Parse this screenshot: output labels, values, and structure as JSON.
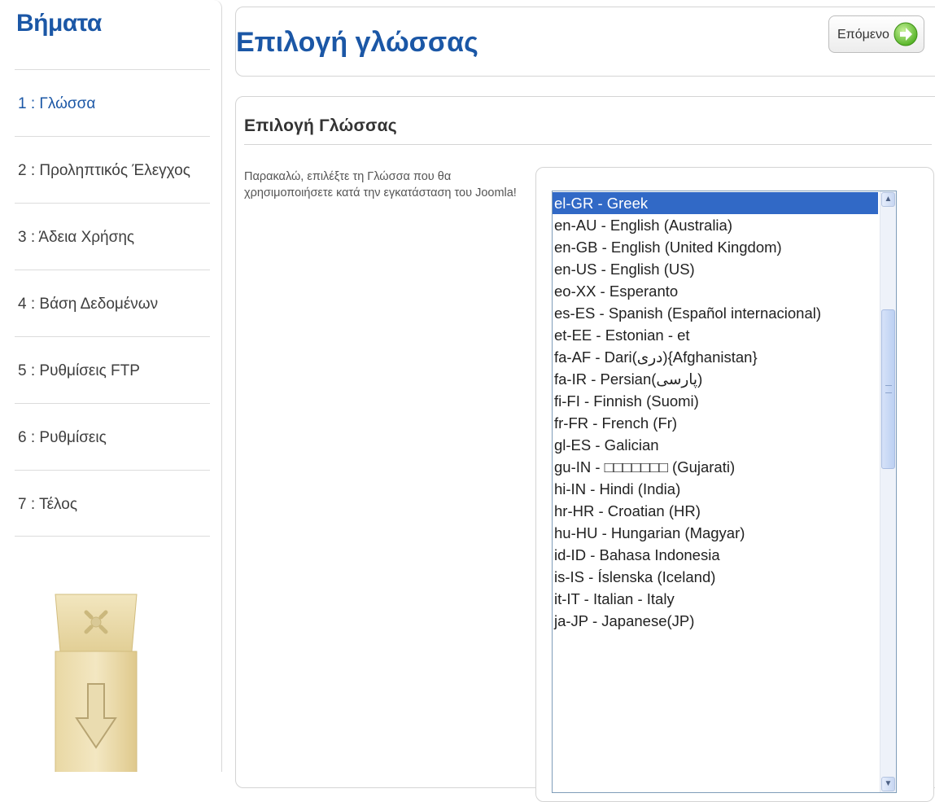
{
  "sidebar": {
    "title": "Βήματα",
    "steps": [
      {
        "label": "1 : Γλώσσα",
        "active": true
      },
      {
        "label": "2 : Προληπτικός Έλεγχος",
        "active": false
      },
      {
        "label": "3 : Άδεια Χρήσης",
        "active": false
      },
      {
        "label": "4 : Βάση Δεδομένων",
        "active": false
      },
      {
        "label": "5 : Ρυθμίσεις FTP",
        "active": false
      },
      {
        "label": "6 : Ρυθμίσεις",
        "active": false
      },
      {
        "label": "7 : Τέλος",
        "active": false
      }
    ],
    "logo_icon": "joomla-install-box-icon"
  },
  "header": {
    "title": "Επιλογή γλώσσας",
    "next_label": "Επόμενο",
    "next_icon": "arrow-right-circle-icon"
  },
  "main": {
    "section_title": "Επιλογή Γλώσσας",
    "description": "Παρακαλώ, επιλέξτε τη Γλώσσα που θα χρησιμοποιήσετε κατά την εγκατάσταση του Joomla!",
    "languages": [
      "el-GR - Greek",
      "en-AU - English (Australia)",
      "en-GB - English (United Kingdom)",
      "en-US - English (US)",
      "eo-XX - Esperanto",
      "es-ES - Spanish (Español internacional)",
      "et-EE - Estonian - et",
      "fa-AF - Dari(دری){Afghanistan}",
      "fa-IR - Persian(پارسی)",
      "fi-FI - Finnish (Suomi)",
      "fr-FR - French (Fr)",
      "gl-ES - Galician",
      "gu-IN - □□□□□□□ (Gujarati)",
      "hi-IN - Hindi (India)",
      "hr-HR - Croatian (HR)",
      "hu-HU - Hungarian (Magyar)",
      "id-ID - Bahasa Indonesia",
      "is-IS - Íslenska (Iceland)",
      "it-IT - Italian - Italy",
      "ja-JP - Japanese(JP)"
    ],
    "selected_index": 0
  },
  "colors": {
    "accent": "#1b57a6",
    "selection": "#3169c6",
    "next_icon_green": "#5fc22a"
  }
}
